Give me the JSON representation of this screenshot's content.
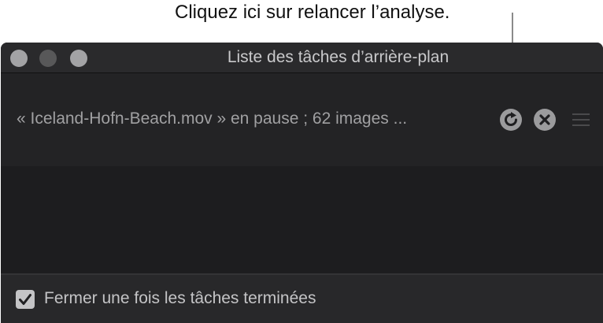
{
  "callout": {
    "text": "Cliquez ici sur relancer l’analyse."
  },
  "window": {
    "title": "Liste des tâches d’arrière-plan",
    "traffic_lights": [
      "close-button",
      "minimize-button",
      "zoom-button"
    ]
  },
  "task": {
    "description": "« Iceland-Hofn-Beach.mov » en pause ; 62 images ...",
    "icons": {
      "reload": "reload-icon",
      "cancel": "cancel-icon",
      "menu": "menu-icon"
    }
  },
  "footer": {
    "checkbox_checked": true,
    "checkbox_label": "Fermer une fois les tâches terminées"
  },
  "colors": {
    "window_bg": "#1f1f21",
    "titlebar_bg": "#2a2a2c",
    "icon_gray": "#9b9b9d"
  }
}
